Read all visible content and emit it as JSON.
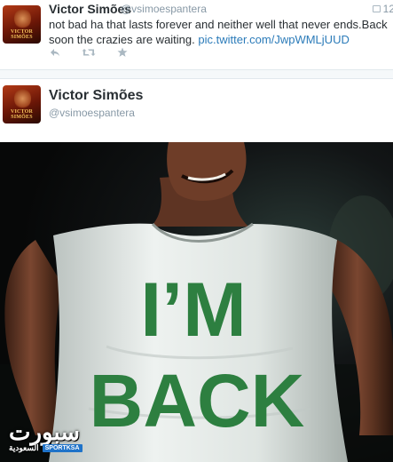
{
  "tweet_top": {
    "name": "Victor Simões",
    "handle": "@vsimoespantera",
    "time": "12",
    "text": "not bad ha that lasts forever and neither well that never ends.Back soon the crazies are waiting. ",
    "link": "pic.twitter.com/JwpWMLjUUD",
    "actions": [
      "reply-icon",
      "retweet-icon",
      "favorite-icon"
    ]
  },
  "tweet_main": {
    "name": "Victor Simões",
    "handle": "@vsimoespantera"
  },
  "avatar": {
    "wordmark": "VICTOR SIMÕES"
  },
  "photo": {
    "shirt_line1": "I’M",
    "shirt_line2": "BACK"
  },
  "watermark": {
    "main": "سبورت",
    "sub": "السعودية",
    "badge": "SPORTKSA"
  },
  "colors": {
    "link": "#2b7bb9",
    "muted": "#8899a6",
    "shirt": "#dfe5e3",
    "shirt_text": "#2d7f40"
  }
}
